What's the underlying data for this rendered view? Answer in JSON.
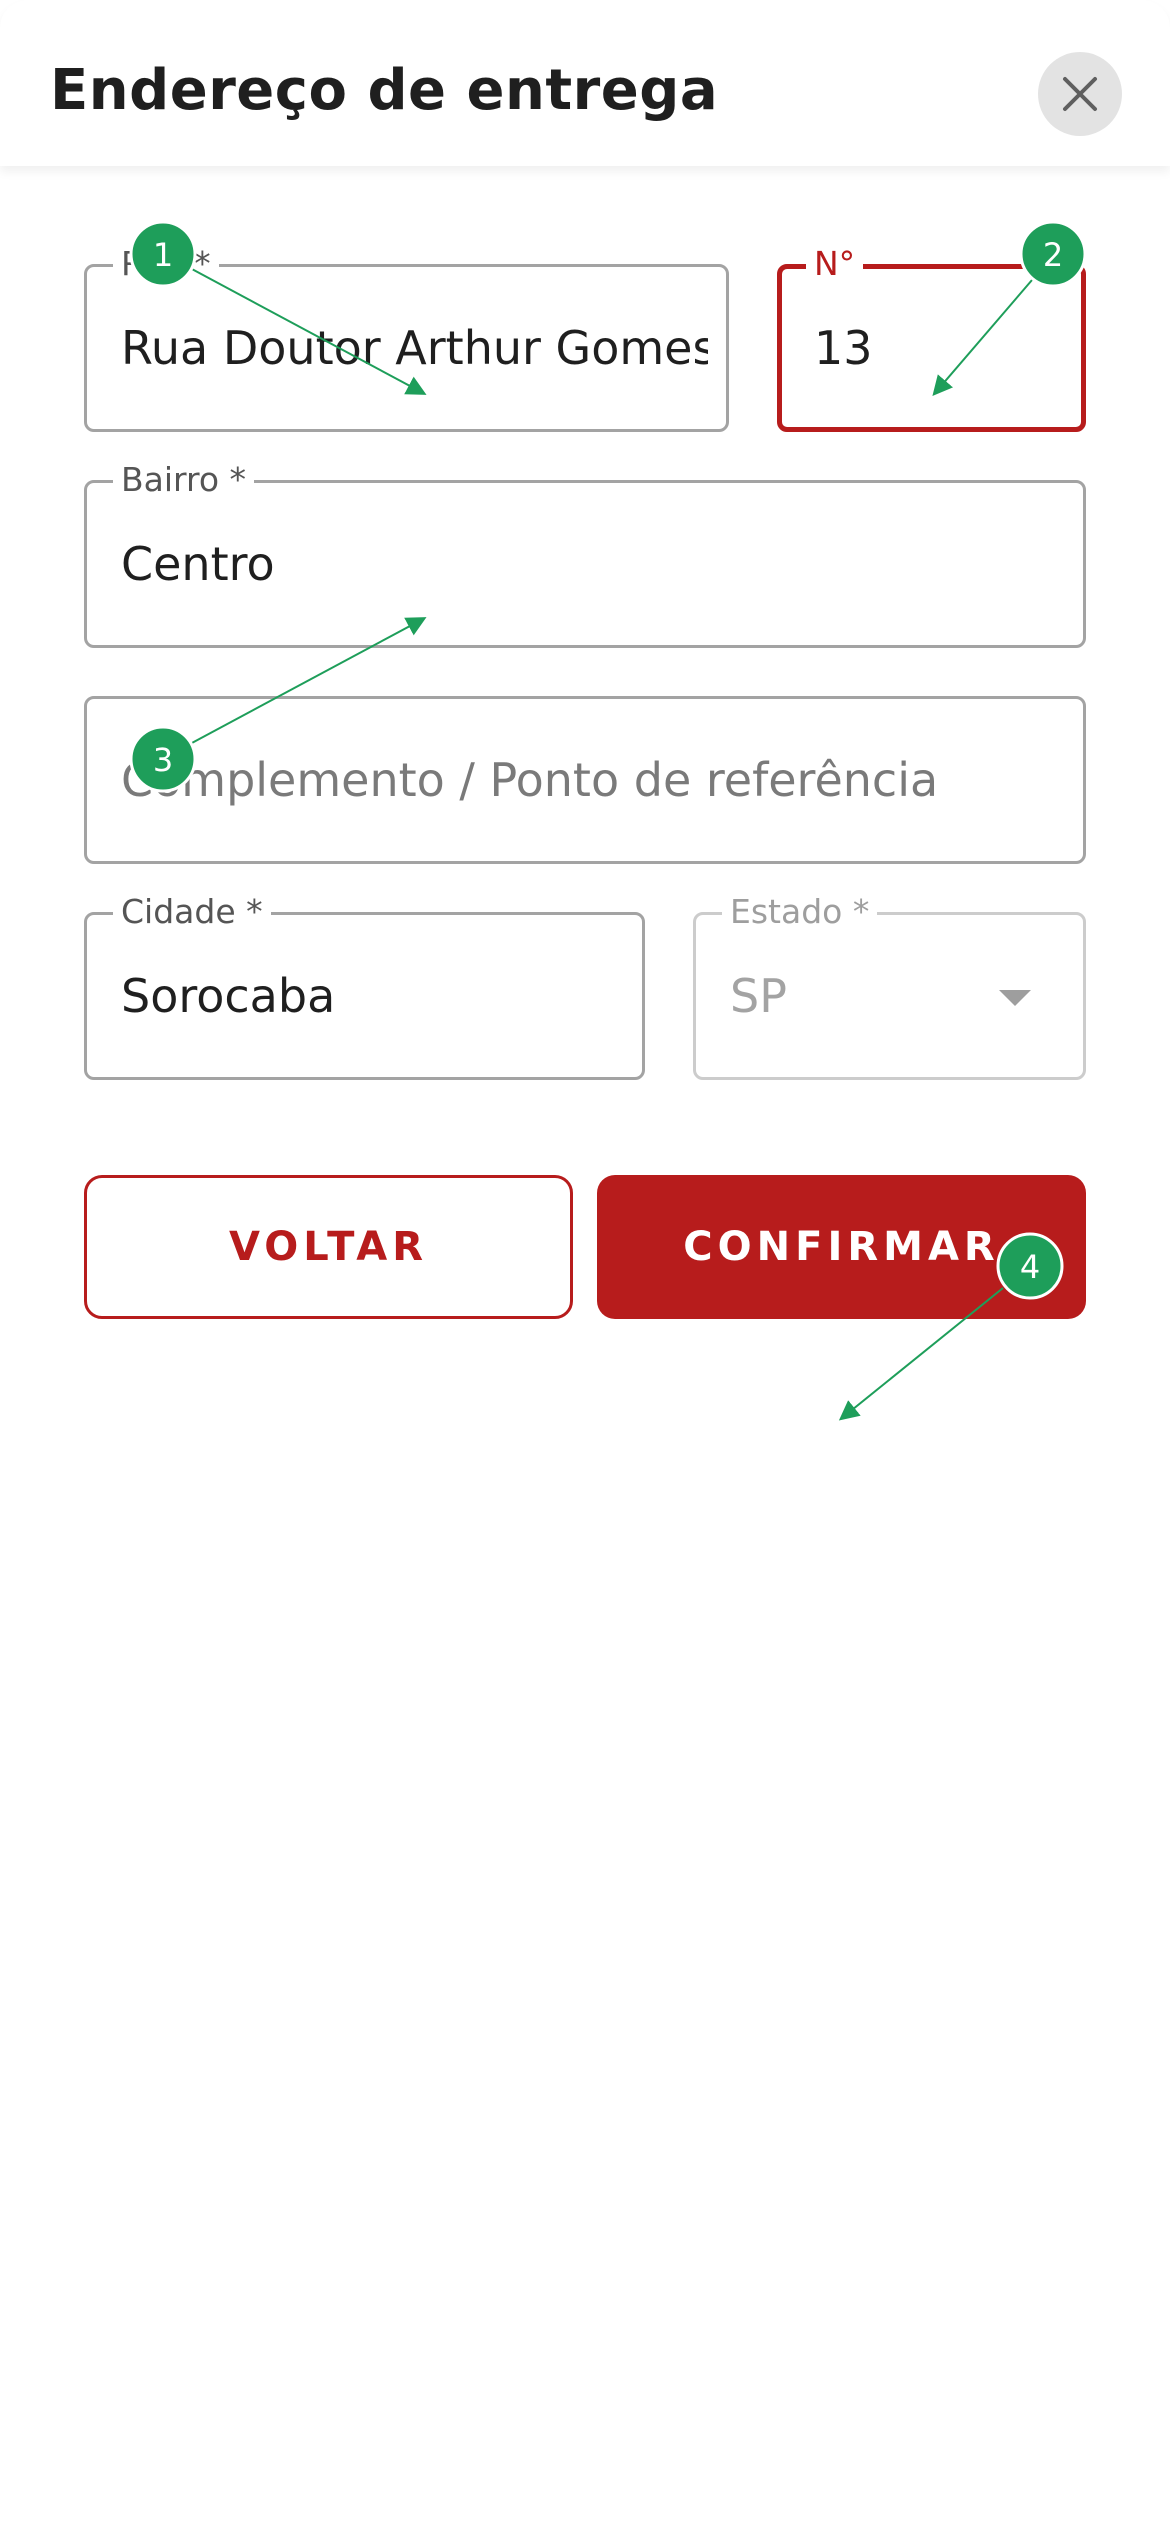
{
  "header": {
    "title": "Endereço de entrega"
  },
  "form": {
    "street": {
      "label": "Rua *",
      "value": "Rua Doutor Arthur Gomes"
    },
    "number": {
      "label": "N°",
      "value": "13"
    },
    "neighborhood": {
      "label": "Bairro *",
      "value": "Centro"
    },
    "complement": {
      "placeholder": "Complemento / Ponto de referência"
    },
    "city": {
      "label": "Cidade *",
      "value": "Sorocaba"
    },
    "state": {
      "label": "Estado *",
      "value": "SP"
    }
  },
  "actions": {
    "back_label": "VOLTAR",
    "confirm_label": "CONFIRMAR"
  },
  "annotations": {
    "markers": [
      "1",
      "2",
      "3",
      "4"
    ]
  },
  "colors": {
    "accent": "#b71c1c",
    "marker": "#1e9e5a"
  },
  "icons": {
    "close": "close-icon",
    "state_dropdown": "chevron-down-icon"
  }
}
